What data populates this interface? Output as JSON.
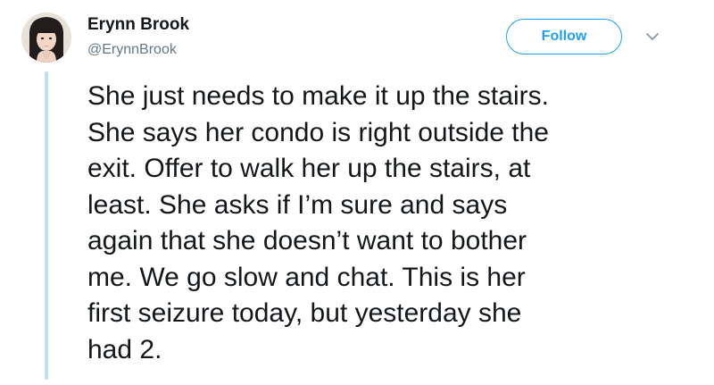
{
  "author": {
    "display_name": "Erynn Brook",
    "handle": "@ErynnBrook"
  },
  "follow_button": {
    "label": "Follow"
  },
  "menu": {
    "icon": "chevron-down-icon"
  },
  "tweet": {
    "lines": [
      "She just needs to make it up the stairs.",
      "She says her condo is right outside the",
      "exit. Offer to walk her up the stairs, at",
      "least. She asks if I’m sure and says",
      "again that she doesn’t want to bother",
      "me. We go slow and chat. This is her",
      "first seizure today, but yesterday she",
      "had 2."
    ]
  },
  "colors": {
    "accent": "#1da1f2",
    "thread_line": "#bfe0f5",
    "text": "#14171a",
    "secondary_text": "#657786"
  }
}
